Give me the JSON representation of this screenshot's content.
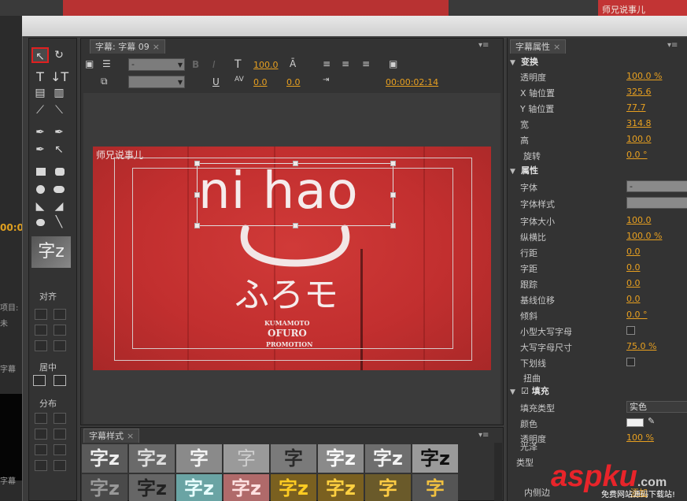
{
  "background": {
    "top_right_text": "师兄说事儿",
    "left_time": "00:0",
    "left_labels": [
      "项目:",
      "未",
      "字幕",
      "字幕"
    ]
  },
  "tools": {
    "align_label": "对齐",
    "center_label": "居中",
    "distribute_label": "分布",
    "style_preview": "字z",
    "selected_tool": "selection-tool"
  },
  "title_panel": {
    "tab_label": "字幕: 字幕 09",
    "tab_close": "×",
    "menu": "▾≡",
    "font_dd": "-",
    "style_dd": "",
    "font_size": "100.0",
    "kerning": "0.0",
    "leading": "0.0",
    "timecode": "00:00:02:14",
    "bold_label": "B",
    "italic_label": "I",
    "underline_label": "U"
  },
  "canvas": {
    "main_text": "ni hao",
    "kana_text": "ふろモ",
    "brand_top": "师兄说事儿",
    "line1": "KUMAMOTO",
    "line2": "OFURO",
    "line3": "PROMOTION"
  },
  "styles_panel": {
    "tab_label": "字幕样式",
    "tab_close": "×",
    "menu": "▾≡",
    "swatch_glyph": "字z",
    "swatch_glyph_alt": "字"
  },
  "properties": {
    "tab_label": "字幕属性",
    "tab_close": "×",
    "menu": "▾≡",
    "sections": {
      "transform": "变换",
      "attributes": "属性",
      "fill": "填充"
    },
    "rows": {
      "opacity": {
        "label": "透明度",
        "value": "100.0 %"
      },
      "x_pos": {
        "label": "X 轴位置",
        "value": "325.6"
      },
      "y_pos": {
        "label": "Y 轴位置",
        "value": "77.7"
      },
      "width": {
        "label": "宽",
        "value": "314.8"
      },
      "height": {
        "label": "高",
        "value": "100.0"
      },
      "rotation": {
        "label": "旋转",
        "value": "0.0 °"
      },
      "font": {
        "label": "字体",
        "value": "-"
      },
      "font_style": {
        "label": "字体样式",
        "value": ""
      },
      "font_size": {
        "label": "字体大小",
        "value": "100.0"
      },
      "aspect": {
        "label": "纵横比",
        "value": "100.0 %"
      },
      "leading": {
        "label": "行距",
        "value": "0.0"
      },
      "kerning": {
        "label": "字距",
        "value": "0.0"
      },
      "tracking": {
        "label": "跟踪",
        "value": "0.0"
      },
      "baseline": {
        "label": "基线位移",
        "value": "0.0"
      },
      "slant": {
        "label": "倾斜",
        "value": "0.0 °"
      },
      "small_caps": {
        "label": "小型大写字母"
      },
      "caps_size": {
        "label": "大写字母尺寸",
        "value": "75.0 %"
      },
      "underline": {
        "label": "下划线"
      },
      "distort": {
        "label": "扭曲"
      },
      "fill_type": {
        "label": "填充类型",
        "value": "实色"
      },
      "color": {
        "label": "颜色"
      },
      "fill_opacity": {
        "label": "透明度",
        "value": "100 %"
      },
      "sheen": {
        "label": "光泽"
      },
      "type": {
        "label": "类型"
      },
      "inner_stroke": {
        "label": "内侧边",
        "value": "添加"
      }
    }
  },
  "watermark": {
    "brand": "aspku",
    "tld": ".com",
    "sub": "免费网站源码下载站!"
  },
  "colors": {
    "accent_value": "#e8a020",
    "selection_red": "#e02020",
    "photo_red": "#c22f2f"
  }
}
